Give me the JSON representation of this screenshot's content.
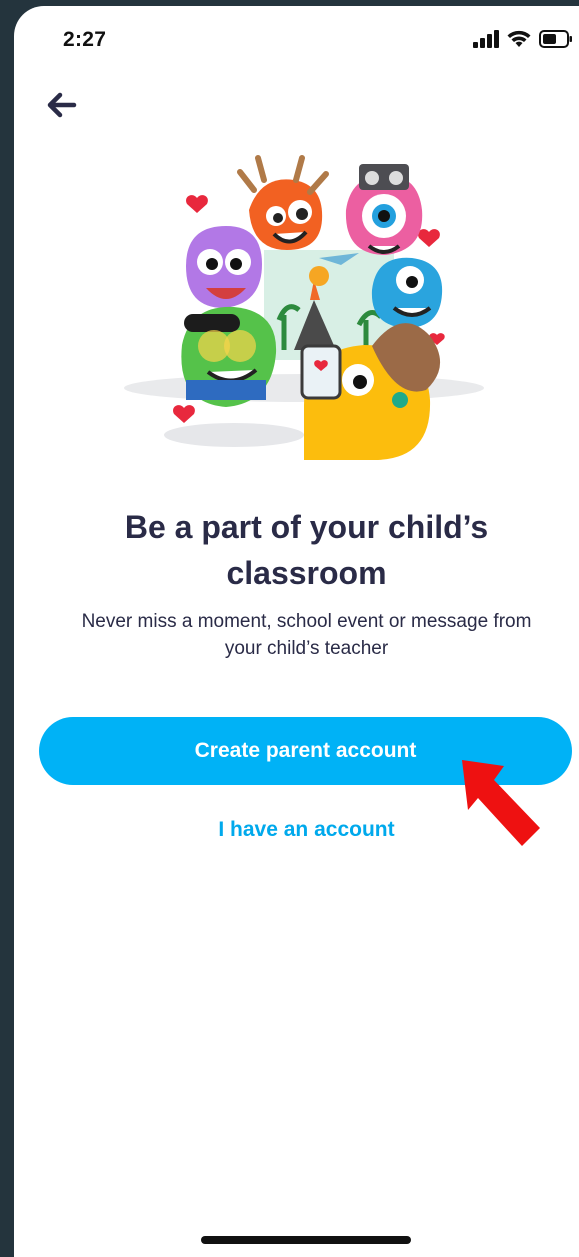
{
  "status_bar": {
    "time": "2:27",
    "icons": [
      "cellular-signal-icon",
      "wifi-icon",
      "battery-icon"
    ]
  },
  "header": {
    "back_icon": "back-arrow-icon"
  },
  "hero": {
    "illustration": "classdojo-monsters-illustration",
    "headline_line1": "Be a part of your child’s",
    "headline_line2": "classroom",
    "subtext_line1": "Never miss a moment, school event or message from",
    "subtext_line2": "your child’s teacher"
  },
  "actions": {
    "create_account_label": "Create parent account",
    "existing_account_label": "I have an account"
  },
  "annotation": {
    "arrow_color": "#ee1111"
  },
  "colors": {
    "primary": "#00b2f6",
    "link": "#00a9ec",
    "text": "#2a2b47",
    "frame": "#24343d"
  }
}
